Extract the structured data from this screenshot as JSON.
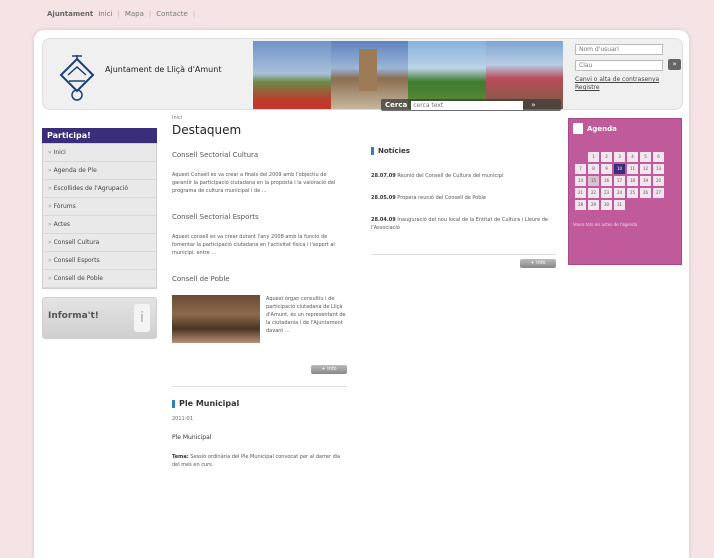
{
  "topbar": {
    "brand": "Ajuntament",
    "links": [
      "Inici",
      "Mapa",
      "Contacte"
    ]
  },
  "header": {
    "org_name": "Ajuntament de Lliçà d'Amunt",
    "search_label": "Cerca",
    "search_placeholder": "cerca text",
    "search_go": "»",
    "login": {
      "user_placeholder": "Nom d'usuari",
      "password_placeholder": "Clau",
      "go": "»",
      "link_forgot": "Canvi o alta de contrasenya",
      "link_register": "Registre"
    }
  },
  "sidebar": {
    "title": "Participa!",
    "items": [
      "Inici",
      "Agenda de Ple",
      "Escollides de l'Agrupació",
      "Fòrums",
      "Actes",
      "Consell Cultura",
      "Consell Esports",
      "Consell de Poble"
    ],
    "info_title": "Informa't!"
  },
  "content": {
    "breadcrumb": "Inici",
    "title": "Destaquem",
    "sections": [
      {
        "title": "Consell Sectorial Cultura",
        "text": "Aquest Consell es va crear a finals del 2009 amb l'objectiu de garantir la participació ciutadana en la proposta i la valoració del programa de cultura municipal i de ..."
      },
      {
        "title": "Consell Sectorial Esports",
        "text": "Aquest consell es va crear durant l'any 2008 amb la funció de fomentar la participació ciutadana en l'activitat física i l'esport al municipi, entre ..."
      },
      {
        "title": "Consell de Poble",
        "img_text": "Aquest òrgan consultiu i de participació ciutadana de Lliçà d'Amunt, és un representant de la ciutadania i de l'Ajuntament davant ..."
      }
    ],
    "more_label": "+ info",
    "ple": {
      "title": "Ple Municipal",
      "date": "2011-01",
      "subtitle": "Ple Municipal",
      "text_label": "Tema:",
      "text": "Sessió ordinària del Ple Municipal convocat per al darrer dia del mes en curs."
    }
  },
  "news": {
    "title": "Notícies",
    "items": [
      {
        "date": "28.07.09",
        "text": "Reunió del Consell de Cultura del municipi"
      },
      {
        "date": "28.05.09",
        "text": "Propera reunió del Consell de Poble"
      },
      {
        "date": "28.04.09",
        "text": "Inauguració del nou local de la Entitat de Cultura i Lleure de l'Associació"
      }
    ],
    "more_label": "+ info"
  },
  "agenda": {
    "title": "Agenda",
    "days": [
      "",
      "1",
      "2",
      "3",
      "4",
      "5",
      "6",
      "7",
      "8",
      "9",
      "10",
      "11",
      "12",
      "13",
      "14",
      "15",
      "16",
      "17",
      "18",
      "19",
      "20",
      "21",
      "22",
      "23",
      "24",
      "25",
      "26",
      "27",
      "28",
      "29",
      "30",
      "31",
      "",
      "",
      ""
    ],
    "today": "10",
    "event_days": [
      "15"
    ],
    "footer": "Veure tots els actes de l'agenda"
  },
  "colors": {
    "sidebar_title_bg": "#3a2e7a",
    "agenda_bg": "#c05a9a",
    "accent_blue": "#2f7fc1",
    "page_bg": "#f6e4e4"
  }
}
